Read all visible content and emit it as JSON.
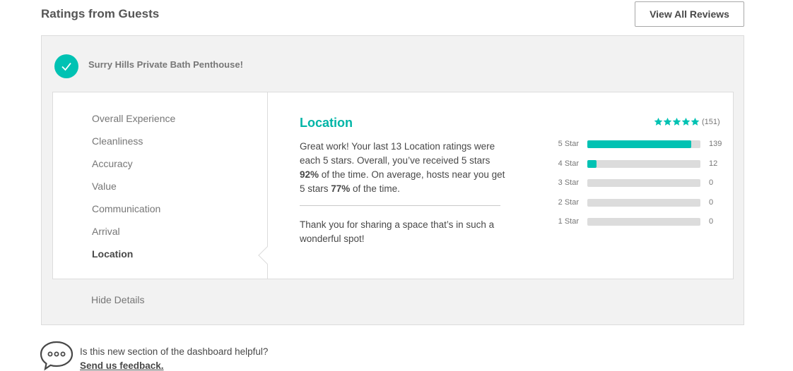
{
  "header": {
    "title": "Ratings from Guests",
    "view_all_label": "View All Reviews"
  },
  "listing": {
    "name": "Surry Hills Private Bath Penthouse!",
    "status_icon": "check-icon"
  },
  "categories": [
    {
      "label": "Overall Experience",
      "active": false
    },
    {
      "label": "Cleanliness",
      "active": false
    },
    {
      "label": "Accuracy",
      "active": false
    },
    {
      "label": "Value",
      "active": false
    },
    {
      "label": "Communication",
      "active": false
    },
    {
      "label": "Arrival",
      "active": false
    },
    {
      "label": "Location",
      "active": true
    }
  ],
  "detail": {
    "title": "Location",
    "text_part1": "Great work! Your last 13 Location ratings were each 5 stars. Overall, you’ve received 5 stars ",
    "pct_you": "92%",
    "text_part2": " of the time. On average, hosts near you get 5 stars ",
    "pct_hosts": "77%",
    "text_part3": " of the time.",
    "thanks": "Thank you for sharing a space that’s in such a wonderful spot!"
  },
  "rating_summary": {
    "stars": 5,
    "count_label": "(151)"
  },
  "breakdown": [
    {
      "label": "5 Star",
      "count": "139",
      "fraction": 0.92
    },
    {
      "label": "4 Star",
      "count": "12",
      "fraction": 0.08
    },
    {
      "label": "3 Star",
      "count": "0",
      "fraction": 0
    },
    {
      "label": "2 Star",
      "count": "0",
      "fraction": 0
    },
    {
      "label": "1 Star",
      "count": "0",
      "fraction": 0
    }
  ],
  "hide_details_label": "Hide Details",
  "feedback": {
    "question": "Is this new section of the dashboard helpful?",
    "link": "Send us feedback.",
    "icon": "chat-bubble-icon"
  },
  "colors": {
    "accent": "#00c2b3",
    "accent_text": "#00b5a7",
    "track": "#dcdcdc"
  }
}
